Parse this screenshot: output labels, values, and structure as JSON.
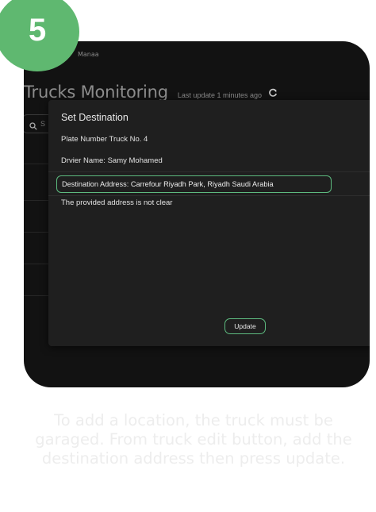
{
  "step": {
    "number": "5",
    "color": "#5fb870"
  },
  "app": {
    "company": "Manaa",
    "title": "Trucks Monitoring",
    "last_update": "Last update 1 minutes ago",
    "refresh_icon": "refresh-icon"
  },
  "search": {
    "placeholder": "S",
    "icon": "search-icon"
  },
  "dialog": {
    "title": "Set Destination",
    "plate": "Plate Number Truck No. 4",
    "driver": "Drvier Name: Samy Mohamed",
    "destination": "Destination Address: Carrefour Riyadh Park, Riyadh Saudi Arabia",
    "error": "The provided address is not clear",
    "update_label": "Update"
  },
  "caption": "To add a location, the truck must be garaged. From truck edit button, add the destination address then press update.",
  "colors": {
    "accent": "#5dba7f",
    "background": "#121212",
    "dialog": "#1f1f1f"
  }
}
